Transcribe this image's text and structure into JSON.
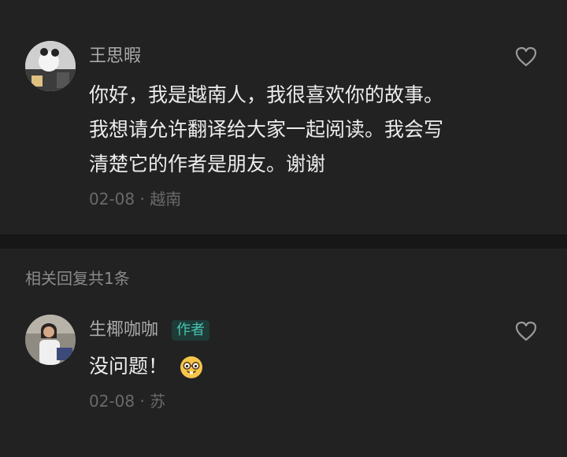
{
  "main_comment": {
    "author": "王思暇",
    "lines": [
      "你好，我是越南人，我很喜欢你的故事。",
      "我想请允许翻译给大家一起阅读。我会写",
      "清楚它的作者是朋友。谢谢"
    ],
    "date": "02-08",
    "location": "越南",
    "like_icon": "heart-outline-icon"
  },
  "replies": {
    "header": "相关回复共1条",
    "items": [
      {
        "author": "生椰咖咖",
        "badge": "作者",
        "text": "没问题！",
        "emoji": "nerd-face-emoji",
        "date": "02-08",
        "location": "苏",
        "like_icon": "heart-outline-icon"
      }
    ]
  },
  "colors": {
    "background": "#222222",
    "divider": "#171717",
    "badge_text": "#47c3b0",
    "badge_bg": "#1f3b37"
  }
}
